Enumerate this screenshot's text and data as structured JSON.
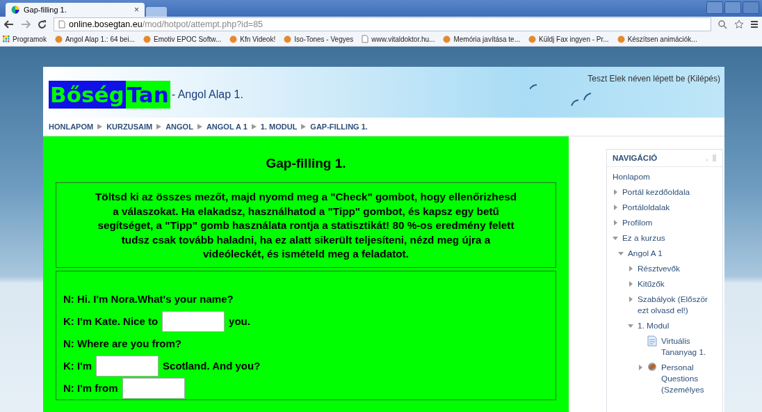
{
  "browser": {
    "tab": {
      "title": "Gap-filling 1.",
      "close": "×"
    },
    "url": {
      "host": "online.bosegtan.eu",
      "path": "/mod/hotpot/attempt.php?id=85"
    },
    "bookmarks": [
      {
        "label": "Programok",
        "kind": "apps"
      },
      {
        "label": "Angol Alap 1.: 64 bei...",
        "kind": "site"
      },
      {
        "label": "Emotiv EPOC Softw...",
        "kind": "site"
      },
      {
        "label": "Kfn Videok!",
        "kind": "site"
      },
      {
        "label": "Iso-Tones - Vegyes",
        "kind": "site"
      },
      {
        "label": "www.vitaldoktor.hu...",
        "kind": "page"
      },
      {
        "label": "Memória javítása te...",
        "kind": "site"
      },
      {
        "label": "Küldj Fax ingyen - Pr...",
        "kind": "site"
      },
      {
        "label": "Készítsen animációk...",
        "kind": "site"
      }
    ]
  },
  "header": {
    "logo": [
      "Bőség",
      "Tan"
    ],
    "subtitle": "- Angol Alap 1.",
    "login": "Teszt Elek néven lépett be (Kilépés)"
  },
  "breadcrumb": [
    "HONLAPOM",
    "KURZUSAIM",
    "ANGOL",
    "ANGOL A 1",
    "1. MODUL",
    "GAP-FILLING 1."
  ],
  "exercise": {
    "title": "Gap-filling 1.",
    "instructions": "Töltsd ki az összes mezőt, majd nyomd meg a \"Check\" gombot, hogy ellenőrizhesd a válaszokat. Ha elakadsz, használhatod a \"Tipp\" gombot, és kapsz egy betű segítséget, a \"Tipp\" gomb használata rontja a statisztikát! 80 %-os eredmény felett tudsz csak tovább haladni, ha ez alatt sikerült teljesíteni, nézd meg újra a videóleckét, és ismételd meg a feladatot.",
    "lines": [
      [
        {
          "kind": "text",
          "text": "N: Hi. I'm Nora.What's your name?"
        }
      ],
      [
        {
          "kind": "text",
          "text": "K: I'm Kate. Nice to"
        },
        {
          "kind": "gap"
        },
        {
          "kind": "text",
          "text": "you."
        }
      ],
      [
        {
          "kind": "text",
          "text": "N: Where are you from?"
        }
      ],
      [
        {
          "kind": "text",
          "text": "K: I'm"
        },
        {
          "kind": "gap"
        },
        {
          "kind": "text",
          "text": "Scotland. And you?"
        }
      ],
      [
        {
          "kind": "text",
          "text": "N: I'm from"
        },
        {
          "kind": "gap"
        }
      ]
    ]
  },
  "navigation": {
    "title": "NAVIGÁCIÓ",
    "items": [
      {
        "label": "Honlapom",
        "kind": "home"
      },
      {
        "label": "Portál kezdőoldala",
        "kind": "branch",
        "expanded": false
      },
      {
        "label": "Portáloldalak",
        "kind": "branch",
        "expanded": false
      },
      {
        "label": "Profilom",
        "kind": "branch",
        "expanded": false
      },
      {
        "label": "Ez a kurzus",
        "kind": "branch",
        "expanded": true,
        "children": [
          {
            "label": "Angol A 1",
            "kind": "branch",
            "expanded": true,
            "children": [
              {
                "label": "Résztvevők",
                "kind": "branch",
                "expanded": false
              },
              {
                "label": "Kitűzők",
                "kind": "branch",
                "expanded": false
              },
              {
                "label": "Szabályok (Először ezt olvasd el!)",
                "kind": "branch",
                "expanded": false
              },
              {
                "label": "1. Modul",
                "kind": "branch",
                "expanded": true,
                "children": [
                  {
                    "label": "Virtuális Tananyag 1.",
                    "kind": "page"
                  },
                  {
                    "label": "Personal Questions (Személyes",
                    "kind": "quiz",
                    "expanded": false
                  }
                ]
              }
            ]
          }
        ]
      }
    ]
  }
}
